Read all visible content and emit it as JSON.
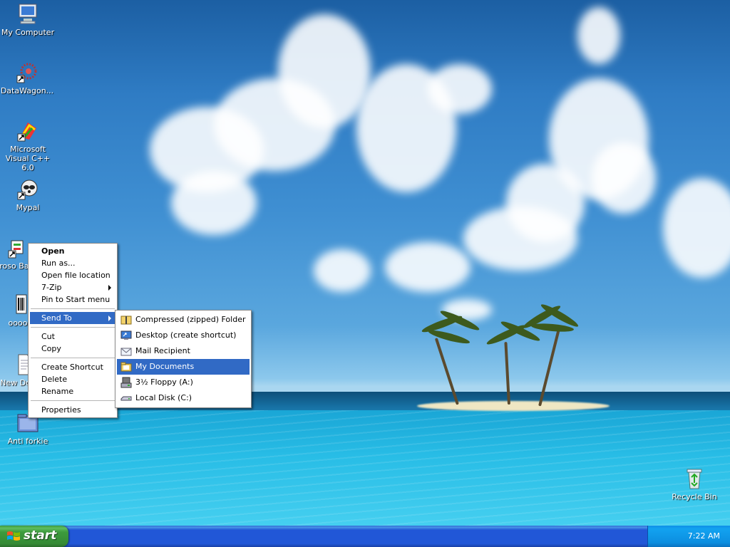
{
  "desktop": {
    "icons": [
      {
        "label": "My Computer"
      },
      {
        "label": "DataWagon..."
      },
      {
        "label": "Microsoft Visual C++ 6.0"
      },
      {
        "label": "Mypal"
      },
      {
        "label": "Microso Basic"
      },
      {
        "label": "oooo"
      },
      {
        "label": "New Docu"
      },
      {
        "label": "Anti forkie"
      },
      {
        "label": "Recycle Bin"
      }
    ]
  },
  "context_menu": {
    "items": [
      {
        "label": "Open"
      },
      {
        "label": "Run as..."
      },
      {
        "label": "Open file location"
      },
      {
        "label": "7-Zip"
      },
      {
        "label": "Pin to Start menu"
      },
      {
        "label": "Send To"
      },
      {
        "label": "Cut"
      },
      {
        "label": "Copy"
      },
      {
        "label": "Create Shortcut"
      },
      {
        "label": "Delete"
      },
      {
        "label": "Rename"
      },
      {
        "label": "Properties"
      }
    ]
  },
  "send_to_menu": {
    "items": [
      {
        "label": "Compressed (zipped) Folder",
        "icon": "zip-folder-icon"
      },
      {
        "label": "Desktop (create shortcut)",
        "icon": "desktop-icon"
      },
      {
        "label": "Mail Recipient",
        "icon": "mail-icon"
      },
      {
        "label": "My Documents",
        "icon": "folder-icon"
      },
      {
        "label": "3½ Floppy (A:)",
        "icon": "floppy-icon"
      },
      {
        "label": "Local Disk (C:)",
        "icon": "hard-disk-icon"
      }
    ],
    "highlighted": "My Documents"
  },
  "taskbar": {
    "start_label": "start",
    "clock": "7:22 AM"
  },
  "colors": {
    "menu_highlight": "#316ac5",
    "taskbar_blue": "#2157d7",
    "start_green": "#3d9b3d"
  }
}
